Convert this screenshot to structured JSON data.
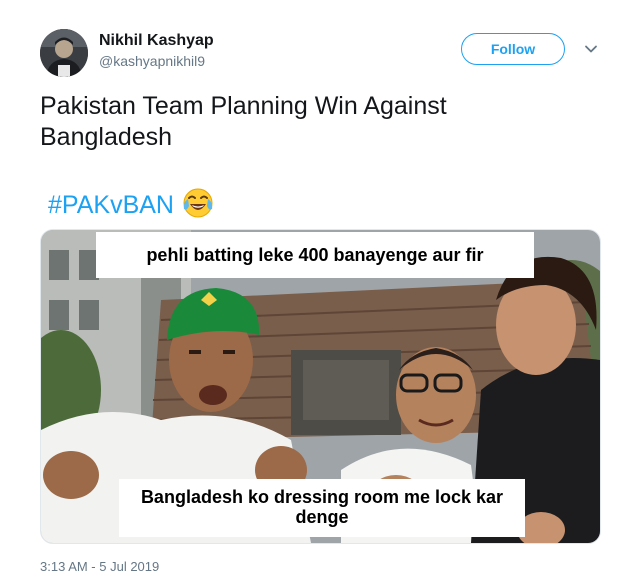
{
  "user": {
    "display_name": "Nikhil Kashyap",
    "handle": "@kashyapnikhil9"
  },
  "follow_button_label": "Follow",
  "tweet": {
    "text": "Pakistan Team Planning Win Against Bangladesh",
    "hashtag": "#PAKvBAN",
    "emoji": "face-with-tears-of-joy"
  },
  "media": {
    "caption_top": "pehli batting leke 400 banayenge aur fir",
    "caption_bottom": "Bangladesh ko dressing room me lock kar denge"
  },
  "timestamp": "3:13 AM - 5 Jul 2019",
  "icons": {
    "more": "chevron-down-icon"
  },
  "colors": {
    "accent": "#1da1f2",
    "text": "#14171a",
    "secondary": "#657786",
    "cap": "#1a8a3a"
  }
}
